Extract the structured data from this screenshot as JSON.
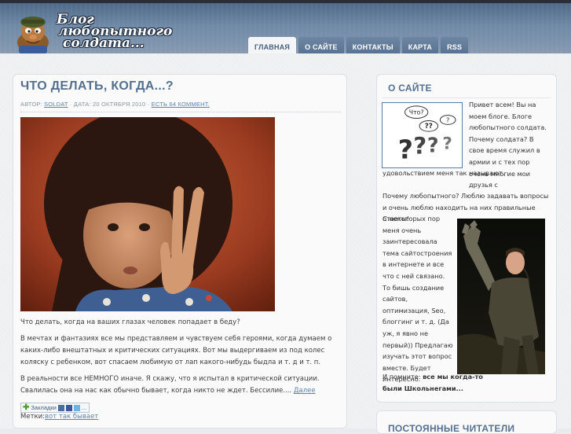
{
  "site": {
    "logo_line1": "Блог",
    "logo_line2": "любопытного",
    "logo_line3": "солдата..."
  },
  "nav": {
    "items": [
      {
        "label": "ГЛАВНАЯ",
        "active": true
      },
      {
        "label": "О САЙТЕ",
        "active": false
      },
      {
        "label": "КОНТАКТЫ",
        "active": false
      },
      {
        "label": "КАРТА",
        "active": false
      },
      {
        "label": "RSS",
        "active": false
      }
    ]
  },
  "post": {
    "title": "ЧТО ДЕЛАТЬ, КОГДА...?",
    "meta_author_prefix": "АВТОР:",
    "meta_author": "SOLDAT",
    "meta_date": "· ДАТА: 20 ОКТЯБРЯ 2010 ·",
    "meta_comments": "ЕСТЬ 64 КОММЕНТ.",
    "p1": "Что делать, когда на ваших глазах человек попадает в беду?",
    "p2": "В мечтах и фантазиях все мы представляем и чувствуем себя героями, когда думаем о каких-либо внештатных и критических ситуациях. Вот мы выдергиваем из под колес коляску с ребенком, вот спасаем любимую от лап какого-нибудь быдла и т. д и т. п.",
    "p3": "В реальности все НЕМНОГО иначе. Я скажу, что я испытал в критической ситуации. Свалилась она на нас как обычно бывает, когда никто не ждет. Бессилие....",
    "more_link": "Далее",
    "share_label": "Закладки",
    "tags_label": "Метки:",
    "tags_value": "вот так бывает"
  },
  "sidebar": {
    "about_title": "О САЙТЕ",
    "about_text1": "Привет всем! Вы на моем блоге. Блоге любопытного солдата. Почему солдата? В свое время служил в армии и с тех пор очень многие мои друзья с",
    "about_text2": "удовольствием меня так называют.",
    "about_text3": "Почему любопытного? Люблю задавать вопросы и очень люблю находить на них правильные ответы!",
    "about_text4": "С некоторых пор меня очень заинтересовала тема сайтостроения в интернете и все что с ней связано. То бишь создание сайтов, оптимизация, Seo, блоггинг и т. д. (Да уж, я явно не первый)) Предлагаю изучать этот вопрос вместе. Будет интересно.",
    "about_text5_prefix": "И помните:",
    "about_text5_bold": "все мы когда-то были Школьнегами...",
    "q_bubble": "Что?",
    "next_title": "ПОСТОЯННЫЕ ЧИТАТЕЛИ"
  },
  "colors": {
    "accent": "#55708f",
    "link": "#5b82b1",
    "header": "#6f89a6"
  }
}
